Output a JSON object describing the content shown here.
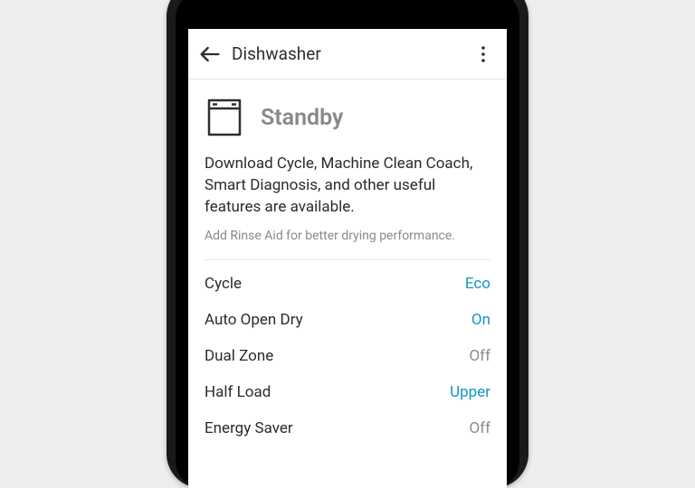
{
  "header": {
    "title": "Dishwasher"
  },
  "status": {
    "label": "Standby"
  },
  "features_description": "Download Cycle, Machine Clean Coach, Smart Diagnosis, and other useful features are available.",
  "hint": "Add Rinse Aid for better drying performance.",
  "colors": {
    "accent": "#1297c8",
    "muted": "#8a8a8a"
  },
  "settings": [
    {
      "label": "Cycle",
      "value": "Eco",
      "active": true
    },
    {
      "label": "Auto Open Dry",
      "value": "On",
      "active": true
    },
    {
      "label": "Dual Zone",
      "value": "Off",
      "active": false
    },
    {
      "label": "Half Load",
      "value": "Upper",
      "active": true
    },
    {
      "label": "Energy Saver",
      "value": "Off",
      "active": false
    }
  ]
}
